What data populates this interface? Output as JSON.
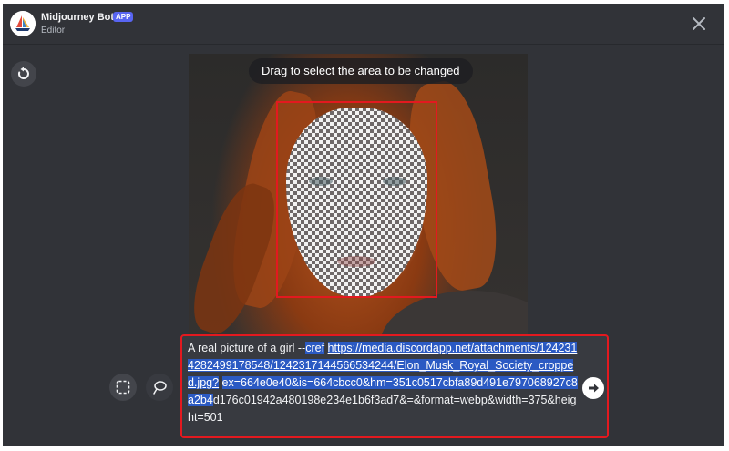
{
  "header": {
    "app_name": "Midjourney Bot",
    "badge": "APP",
    "subtitle": "Editor"
  },
  "canvas": {
    "hint": "Drag to select the area to be changed"
  },
  "prompt": {
    "plain_prefix": "A real picture of a girl --",
    "selected_flag": "cref",
    "selected_link": "https://media.discordapp.net/attachments/1242314282499178548/1242317144566534244/Elon_Musk_Royal_Society_cropped.jpg?",
    "selected_query": "ex=664e0e40&is=664cbcc0&hm=351c0517cbfa89d491e797068927c8a2b4",
    "rest": "d176c01942a480198e234e1b6f3ad7&=&format=webp&width=375&height=501"
  },
  "icons": {
    "close": "close-icon",
    "reset": "reset-icon",
    "rect_select": "rectangle-select-icon",
    "lasso_select": "lasso-select-icon",
    "send": "send-arrow-icon"
  },
  "colors": {
    "modal_bg": "#313338",
    "accent_badge": "#5865f2",
    "highlight_border": "#e3191f",
    "text_selection": "#2b5ac3"
  }
}
